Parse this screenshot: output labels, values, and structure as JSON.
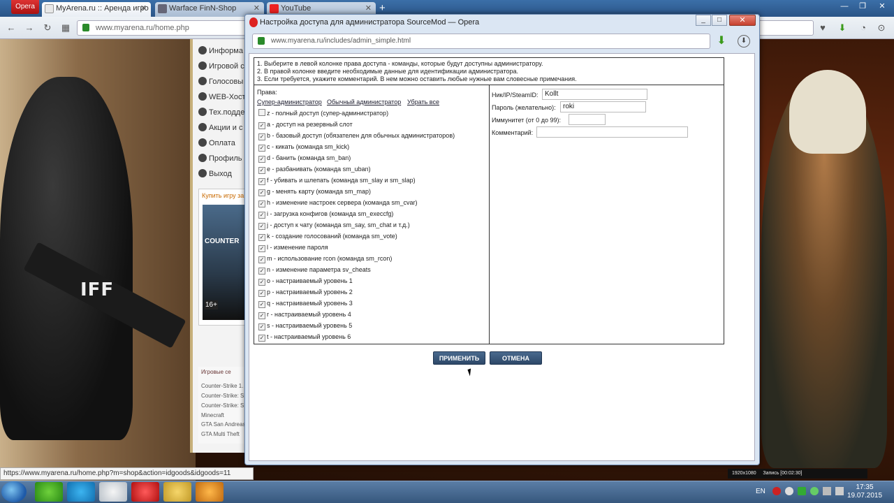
{
  "browser": {
    "menu_label": "Opera",
    "tabs": [
      {
        "label": "MyArena.ru :: Аренда игро"
      },
      {
        "label": "Warface FinN-Shop"
      },
      {
        "label": "YouTube"
      }
    ],
    "address": "www.myarena.ru/home.php"
  },
  "site": {
    "nav": [
      "Информа",
      "Игровой с",
      "Голосовы",
      "WEB-Хости",
      "Тех.подде",
      "Акции и с",
      "Оплата",
      "Профиль",
      "Выход"
    ],
    "buy_title": "Купить игру за",
    "cover_title": "COUNTER",
    "cover_age": "16+",
    "games_title": "Игровые се",
    "games": [
      "Counter-Strike 1.",
      "Counter-Strike: S",
      "Counter-Strike: S",
      "Minecraft",
      "GTA San Andreas",
      "GTA Multi Theft"
    ],
    "soldier_badge": "IFF"
  },
  "popup": {
    "title": "Настройка доступа для администратора SourceMod — Opera",
    "address": "www.myarena.ru/includes/admin_simple.html",
    "instructions": [
      "1. Выберите в левой колонке права доступа - команды, которые будут доступны администратору.",
      "2. В правой колонке введите необходимые данные для идентификации администратора.",
      "3. Если требуется, укажите комментарий. В нем можно оставить любые нужные вам словесные примечания."
    ],
    "rights_title": "Права:",
    "presets": [
      "Супер-администратор",
      "Обычный администратор",
      "Убрать все"
    ],
    "permissions": [
      {
        "label": "z - полный доступ (супер-администратор)",
        "checked": false
      },
      {
        "label": "a - доступ на резервный слот",
        "checked": true
      },
      {
        "label": "b - базовый доступ (обязателен для обычных администраторов)",
        "checked": true
      },
      {
        "label": "c - кикать (команда sm_kick)",
        "checked": true
      },
      {
        "label": "d - банить (команда sm_ban)",
        "checked": true
      },
      {
        "label": "e - разбанивать (команда sm_uban)",
        "checked": true
      },
      {
        "label": "f - убивать и шлепать (команда sm_slay и sm_slap)",
        "checked": true
      },
      {
        "label": "g - менять карту (команда sm_map)",
        "checked": true
      },
      {
        "label": "h - изменение настроек сервера (команда sm_cvar)",
        "checked": true
      },
      {
        "label": "i - загрузка конфигов (команда sm_execcfg)",
        "checked": true
      },
      {
        "label": "j - доступ к чату (команда sm_say, sm_chat и т.д.)",
        "checked": true
      },
      {
        "label": "k - создание голосований (команда sm_vote)",
        "checked": true
      },
      {
        "label": "l - изменение пароля",
        "checked": true
      },
      {
        "label": "m - использование rcon (команда sm_rcon)",
        "checked": true
      },
      {
        "label": "n - изменение параметра sv_cheats",
        "checked": true
      },
      {
        "label": "o - настраиваемый уровень 1",
        "checked": true
      },
      {
        "label": "p - настраиваемый уровень 2",
        "checked": true
      },
      {
        "label": "q - настраиваемый уровень 3",
        "checked": true
      },
      {
        "label": "r - настраиваемый уровень 4",
        "checked": true
      },
      {
        "label": "s - настраиваемый уровень 5",
        "checked": true
      },
      {
        "label": "t - настраиваемый уровень 6",
        "checked": true
      }
    ],
    "fields": {
      "nick_label": "Ник/IP/SteamID:",
      "nick_value": "Kollt",
      "password_label": "Пароль (желательно):",
      "password_value": "roki",
      "immunity_label": "Иммунитет (от 0 до 99):",
      "immunity_value": "",
      "comment_label": "Комментарий:",
      "comment_value": ""
    },
    "apply_label": "ПРИМЕНИТЬ",
    "cancel_label": "ОТМЕНА"
  },
  "status_url": "https://www.myarena.ru/home.php?m=shop&action=idgoods&idgoods=11",
  "recorder": {
    "resolution": "1920x1080",
    "record": "Запись [00:02:30]"
  },
  "taskbar": {
    "lang": "EN",
    "time": "17:35",
    "date": "19.07.2015"
  },
  "colors": {
    "accent": "#2d4868",
    "opera_red": "#cc2222"
  }
}
